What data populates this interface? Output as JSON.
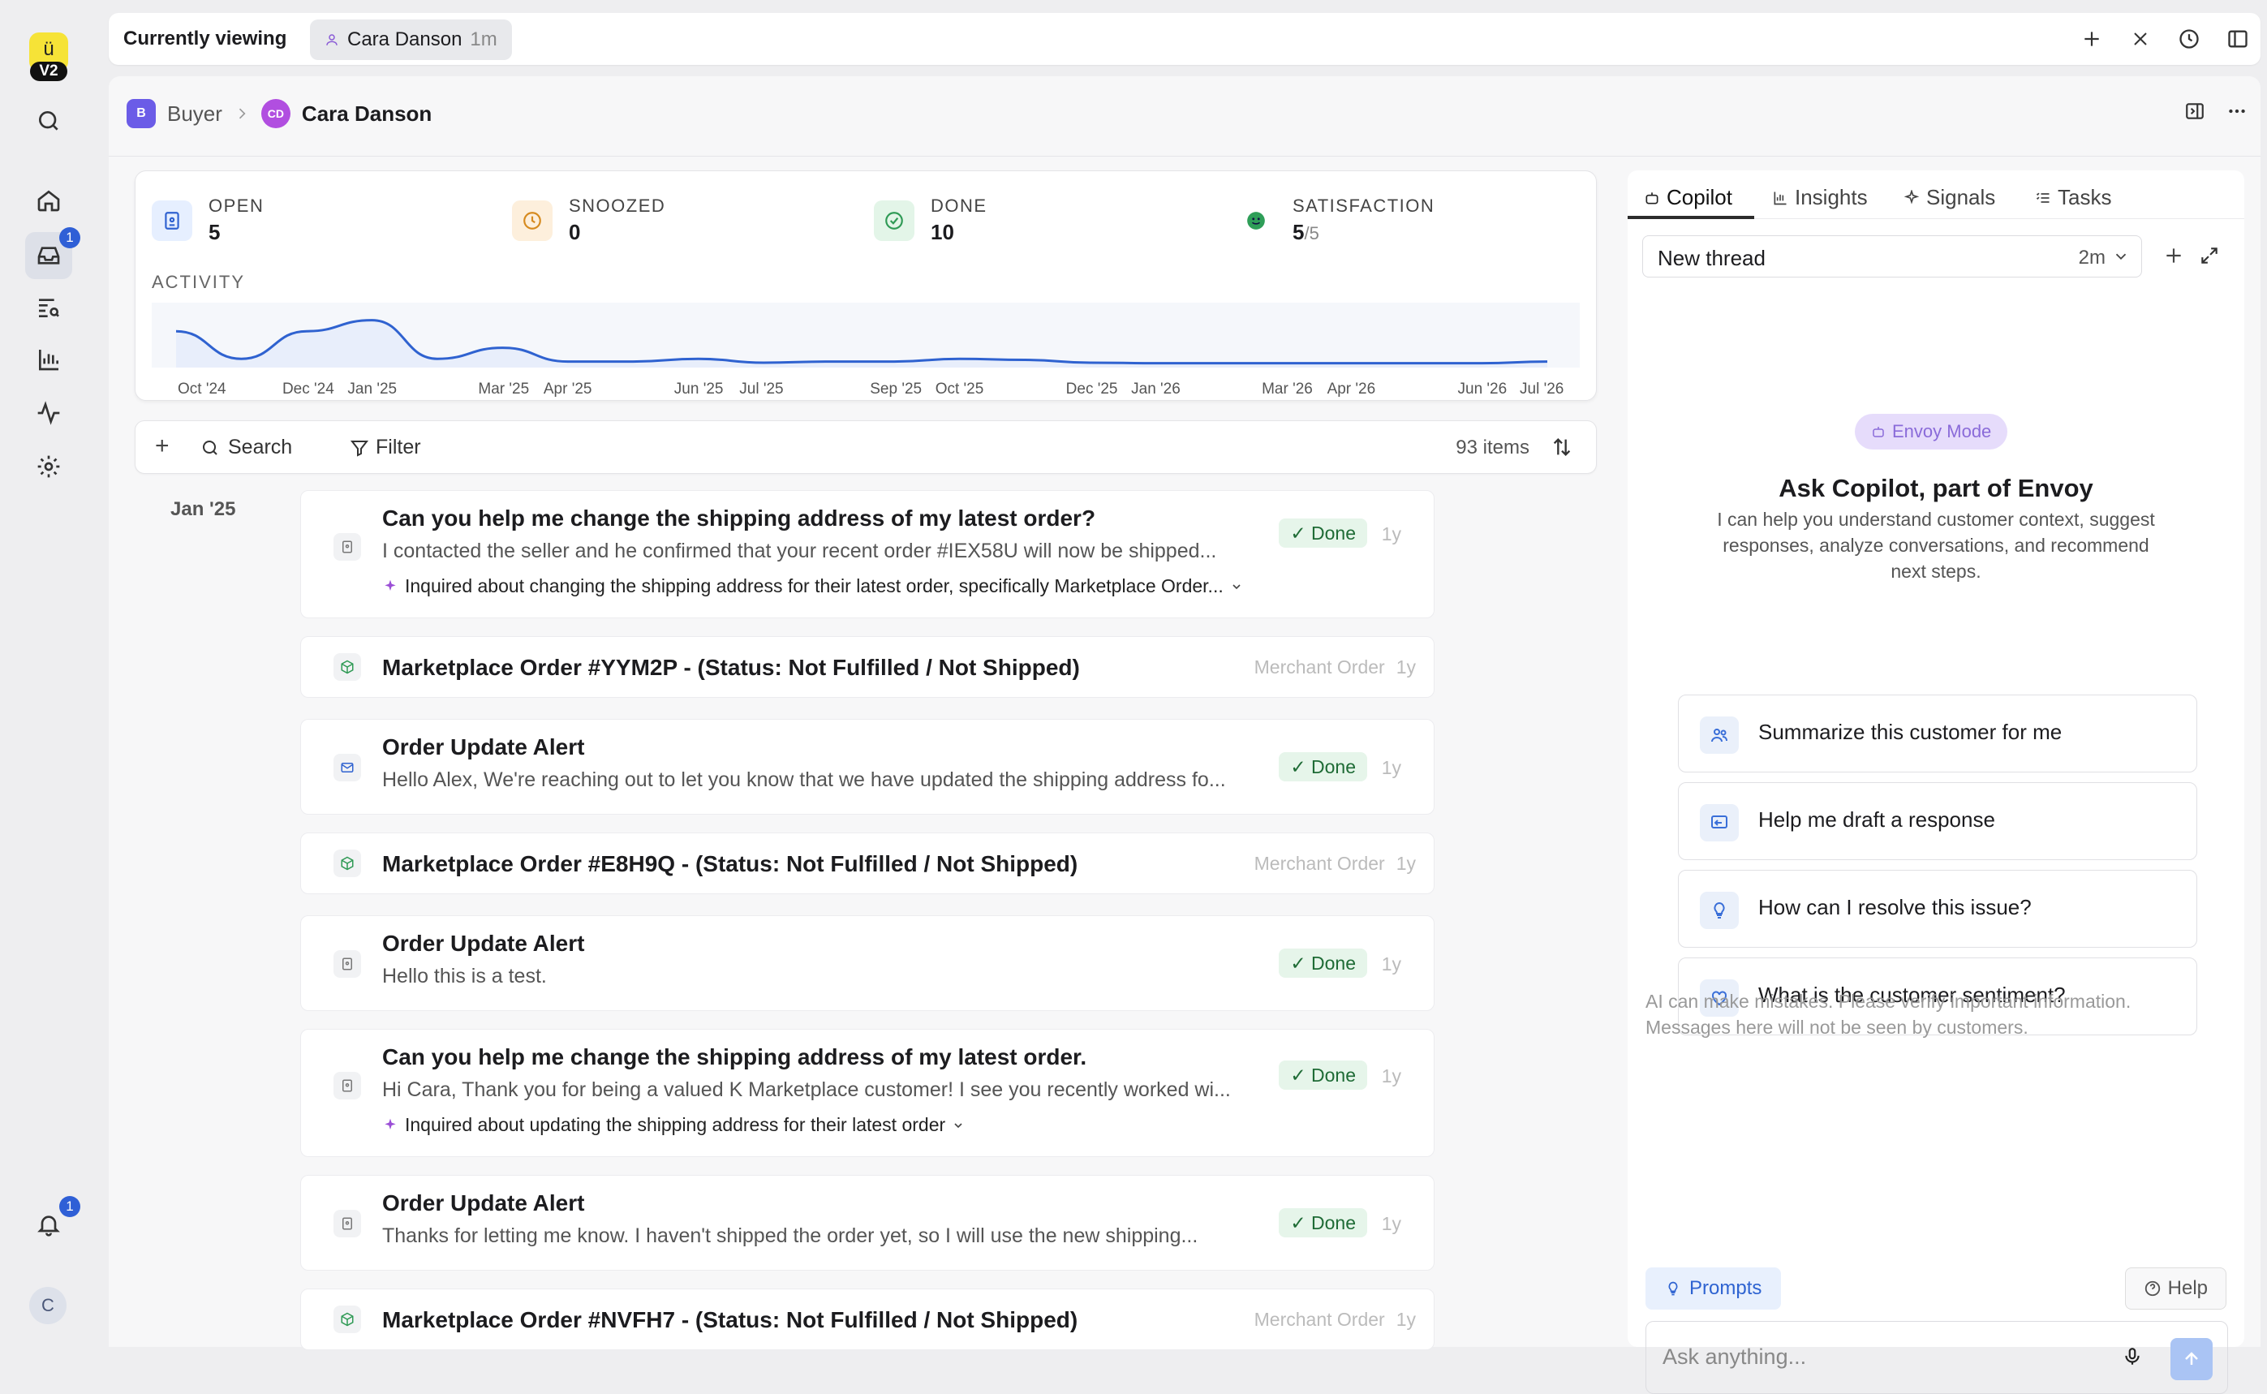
{
  "rail": {
    "logo_text": "V2",
    "inbox_badge": "1",
    "notif_badge": "1",
    "avatar": "C"
  },
  "topbar": {
    "currently_viewing": "Currently viewing",
    "viewer_name": "Cara Danson",
    "viewer_time": "1m"
  },
  "header": {
    "breadcrumb_root_initial": "B",
    "breadcrumb_root": "Buyer",
    "person_initials": "CD",
    "person_name": "Cara Danson"
  },
  "stats": {
    "open_label": "OPEN",
    "open_value": "5",
    "snoozed_label": "SNOOZED",
    "snoozed_value": "0",
    "done_label": "DONE",
    "done_value": "10",
    "satisfaction_label": "SATISFACTION",
    "satisfaction_value": "5",
    "satisfaction_max": "/5",
    "activity_label": "ACTIVITY"
  },
  "chart_data": {
    "type": "line",
    "title": "ACTIVITY",
    "xlabel": "",
    "ylabel": "",
    "x": [
      "Oct '24",
      "Nov '24",
      "Dec '24",
      "Jan '25",
      "Feb '25",
      "Mar '25",
      "Apr '25",
      "May '25",
      "Jun '25",
      "Jul '25",
      "Aug '25",
      "Sep '25",
      "Oct '25",
      "Nov '25",
      "Dec '25",
      "Jan '26",
      "Feb '26",
      "Mar '26",
      "Apr '26",
      "May '26",
      "Jun '26",
      "Jul '26"
    ],
    "tick_labels": [
      "Oct '24",
      "Dec '24",
      "Jan '25",
      "Mar '25",
      "Apr '25",
      "Jun '25",
      "Jul '25",
      "Sep '25",
      "Oct '25",
      "Dec '25",
      "Jan '26",
      "Mar '26",
      "Apr '26",
      "Jun '26",
      "Jul '26"
    ],
    "series": [
      {
        "values": [
          6,
          1,
          6,
          8,
          1,
          3,
          0.5,
          0.5,
          1,
          0.3,
          0.5,
          0.5,
          1,
          0.8,
          0.3,
          0.2,
          0.2,
          0.2,
          0.2,
          0.2,
          0.2,
          0.5
        ]
      }
    ],
    "ylim": [
      0,
      10
    ],
    "grid": false,
    "color": "#2f62d0"
  },
  "listbar": {
    "add": "+",
    "search": "Search",
    "filter": "Filter",
    "count": "93 items"
  },
  "list": {
    "date_group": "Jan '25",
    "items": [
      {
        "title": "Can you help me change the shipping address of my latest order?",
        "snippet": "I contacted the seller and he confirmed that your recent order #IEX58U will now be shipped...",
        "summary": "Inquired about changing the shipping address for their latest order, specifically Marketplace Order...",
        "status": "Done",
        "age": "1y"
      },
      {
        "title": "Marketplace Order #YYM2P - (Status: Not Fulfilled / Not Shipped)",
        "type": "Merchant Order",
        "age": "1y"
      },
      {
        "title": "Order Update Alert",
        "snippet": "Hello Alex, We're reaching out to let you know that we have updated the shipping address fo...",
        "status": "Done",
        "age": "1y"
      },
      {
        "title": "Marketplace Order #E8H9Q - (Status: Not Fulfilled / Not Shipped)",
        "type": "Merchant Order",
        "age": "1y"
      },
      {
        "title": "Order Update Alert",
        "snippet": "Hello this is a test.",
        "status": "Done",
        "age": "1y"
      },
      {
        "title": "Can you help me change the shipping address of my latest order.",
        "snippet": "Hi Cara, Thank you for being a valued K Marketplace customer! I see you recently worked wi...",
        "summary": "Inquired about updating the shipping address for their latest order",
        "status": "Done",
        "age": "1y"
      },
      {
        "title": "Order Update Alert",
        "snippet": "Thanks for letting me know. I haven't shipped the order yet, so I will use the new shipping...",
        "status": "Done",
        "age": "1y"
      },
      {
        "title": "Marketplace Order #NVFH7 - (Status: Not Fulfilled / Not Shipped)",
        "type": "Merchant Order",
        "age": "1y"
      }
    ]
  },
  "copilot": {
    "tabs": [
      "Copilot",
      "Insights",
      "Signals",
      "Tasks"
    ],
    "thread_name": "New thread",
    "thread_time": "2m",
    "mode_badge": "Envoy Mode",
    "heading": "Ask Copilot, part of Envoy",
    "description": "I can help you understand customer context, suggest responses, analyze conversations, and recommend next steps.",
    "suggestions": [
      "Summarize this customer for me",
      "Help me draft a response",
      "How can I resolve this issue?",
      "What is the customer sentiment?"
    ],
    "disclaimer": "AI can make mistakes. Please verify important information. Messages here will not be seen by customers.",
    "prompts_label": "Prompts",
    "help_label": "Help",
    "input_placeholder": "Ask anything..."
  }
}
